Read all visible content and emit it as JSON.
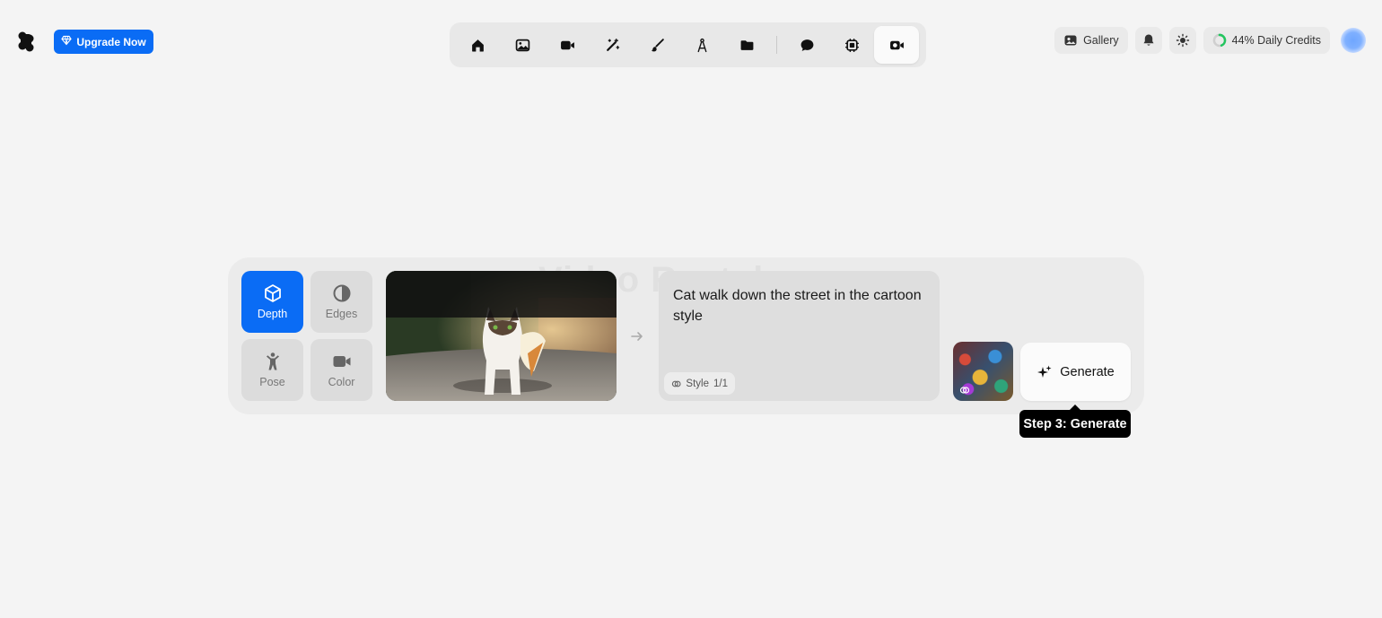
{
  "header": {
    "logo_icon": "krea-logo-icon",
    "upgrade_label": "Upgrade Now",
    "upgrade_color": "#0a6cf5",
    "toolbar": [
      {
        "name": "home",
        "icon": "home-icon",
        "active": false
      },
      {
        "name": "image",
        "icon": "image-icon",
        "active": false
      },
      {
        "name": "video",
        "icon": "video-icon",
        "active": false
      },
      {
        "name": "enhance",
        "icon": "wand-icon",
        "active": false
      },
      {
        "name": "edit",
        "icon": "brush-icon",
        "active": false
      },
      {
        "name": "train",
        "icon": "compass-icon",
        "active": false
      },
      {
        "name": "assets",
        "icon": "folder-icon",
        "active": false
      },
      {
        "name": "chat",
        "icon": "chat-bubble-icon",
        "active": false
      },
      {
        "name": "realtime",
        "icon": "chip-icon",
        "active": false
      },
      {
        "name": "video-restyle",
        "icon": "video-restyle-icon",
        "active": true
      }
    ],
    "gallery_label": "Gallery",
    "credits_label": "44% Daily Credits",
    "credits_percent": 44,
    "credits_color": "#22c55e"
  },
  "main": {
    "watermark": "Video Restyle",
    "modes": [
      {
        "key": "depth",
        "label": "Depth",
        "icon": "cube-icon",
        "active": true
      },
      {
        "key": "edges",
        "label": "Edges",
        "icon": "half-circle-icon",
        "active": false
      },
      {
        "key": "pose",
        "label": "Pose",
        "icon": "person-icon",
        "active": false
      },
      {
        "key": "color",
        "label": "Color",
        "icon": "camera-icon",
        "active": false
      }
    ],
    "prompt": "Cat walk down the street in the cartoon style",
    "style_chip": {
      "label": "Style",
      "count": "1/1"
    },
    "generate_label": "Generate",
    "tooltip": "Step 3: Generate"
  }
}
